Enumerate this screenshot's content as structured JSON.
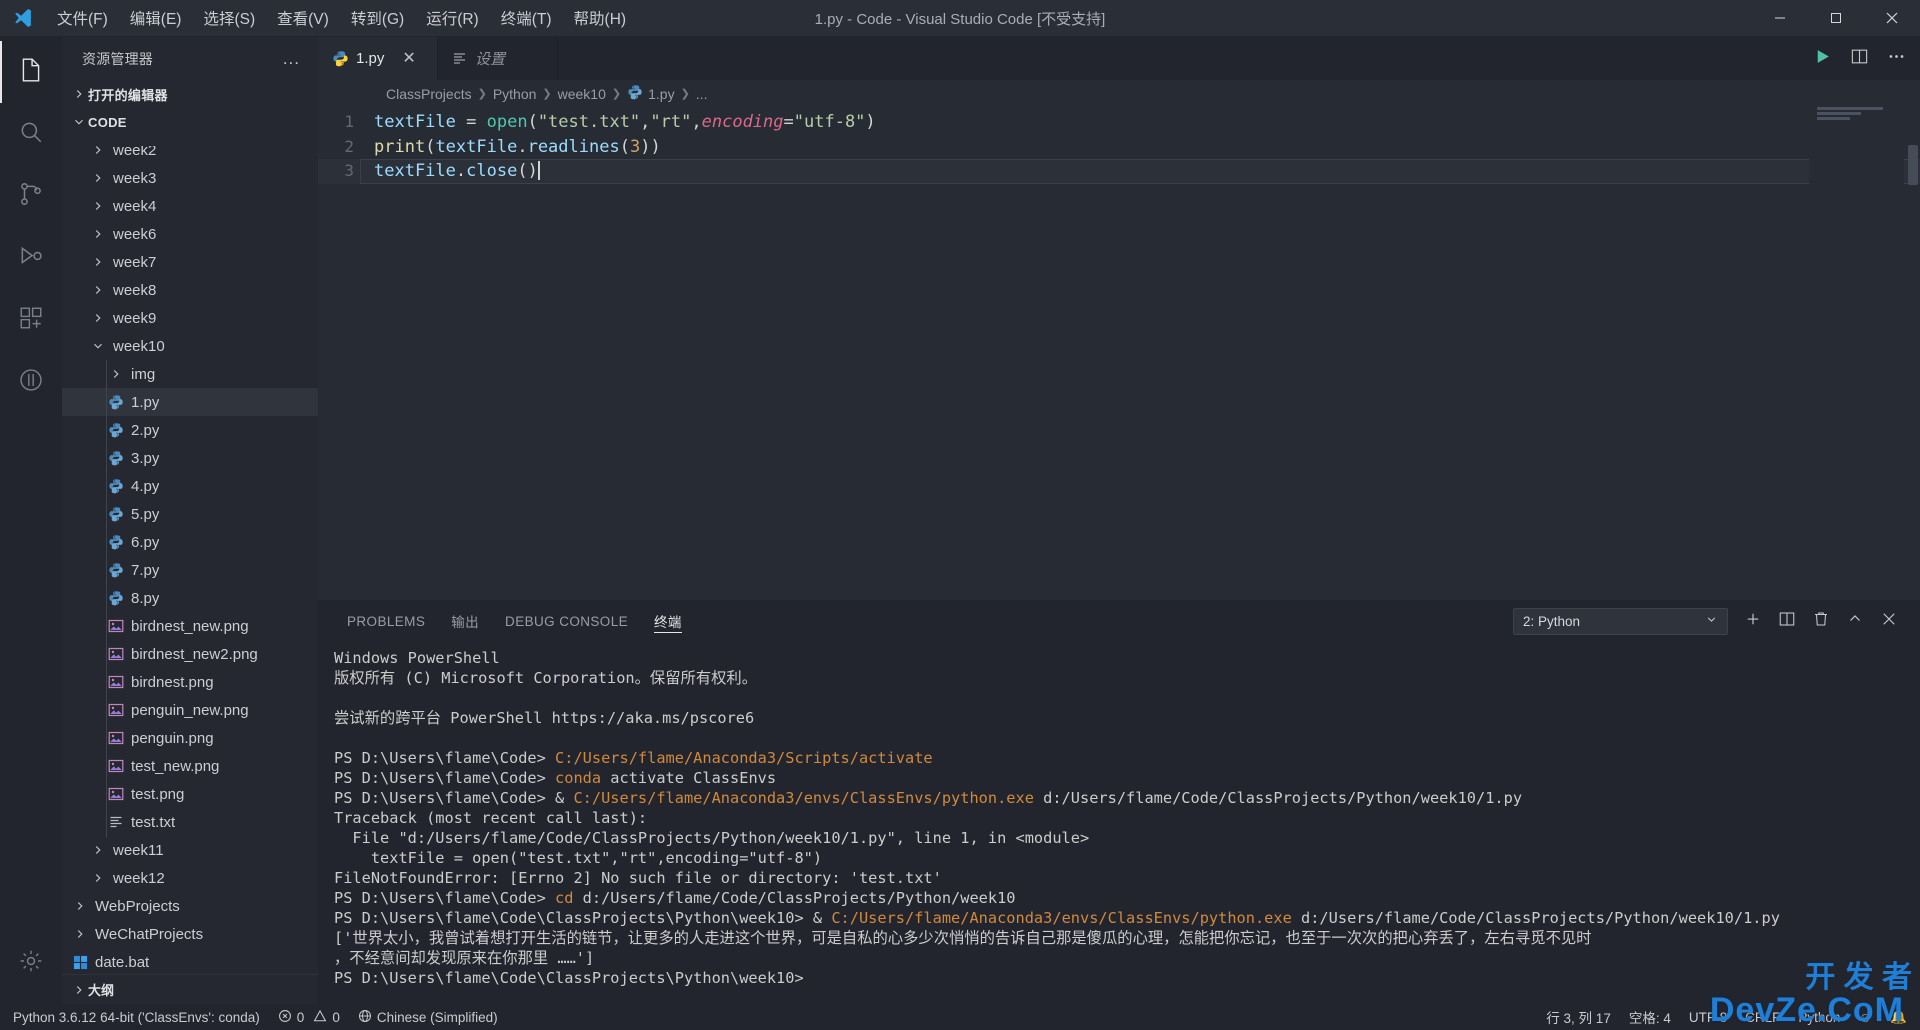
{
  "titlebar": {
    "title": "1.py - Code - Visual Studio Code [不受支持]",
    "menus": [
      "文件(F)",
      "编辑(E)",
      "选择(S)",
      "查看(V)",
      "转到(G)",
      "运行(R)",
      "终端(T)",
      "帮助(H)"
    ],
    "window_buttons": [
      "minimize",
      "maximize",
      "close"
    ]
  },
  "activitybar": {
    "items": [
      {
        "name": "explorer",
        "icon": "files-icon",
        "active": true
      },
      {
        "name": "search",
        "icon": "search-icon",
        "active": false
      },
      {
        "name": "source-control",
        "icon": "source-control-icon",
        "active": false
      },
      {
        "name": "run-and-debug",
        "icon": "run-debug-icon",
        "active": false
      },
      {
        "name": "extensions",
        "icon": "extensions-icon",
        "active": false
      },
      {
        "name": "testing",
        "icon": "beaker-icon",
        "active": false
      }
    ],
    "bottom": [
      {
        "name": "manage",
        "icon": "gear-icon"
      }
    ]
  },
  "sidebar": {
    "title": "资源管理器",
    "more_label": "...",
    "sections": [
      {
        "label": "打开的编辑器",
        "expanded": false
      },
      {
        "label": "CODE",
        "expanded": true
      }
    ],
    "outline_label": "大纲",
    "tree": [
      {
        "label": "week2",
        "icon": "folder",
        "depth": 2,
        "expanded": false,
        "clipped": true
      },
      {
        "label": "week3",
        "icon": "folder",
        "depth": 2,
        "expanded": false
      },
      {
        "label": "week4",
        "icon": "folder",
        "depth": 2,
        "expanded": false
      },
      {
        "label": "week6",
        "icon": "folder",
        "depth": 2,
        "expanded": false
      },
      {
        "label": "week7",
        "icon": "folder",
        "depth": 2,
        "expanded": false
      },
      {
        "label": "week8",
        "icon": "folder",
        "depth": 2,
        "expanded": false
      },
      {
        "label": "week9",
        "icon": "folder",
        "depth": 2,
        "expanded": false
      },
      {
        "label": "week10",
        "icon": "folder",
        "depth": 2,
        "expanded": true
      },
      {
        "label": "img",
        "icon": "folder",
        "depth": 3,
        "expanded": false
      },
      {
        "label": "1.py",
        "icon": "python",
        "depth": 3,
        "selected": true
      },
      {
        "label": "2.py",
        "icon": "python",
        "depth": 3
      },
      {
        "label": "3.py",
        "icon": "python",
        "depth": 3
      },
      {
        "label": "4.py",
        "icon": "python",
        "depth": 3
      },
      {
        "label": "5.py",
        "icon": "python",
        "depth": 3
      },
      {
        "label": "6.py",
        "icon": "python",
        "depth": 3
      },
      {
        "label": "7.py",
        "icon": "python",
        "depth": 3
      },
      {
        "label": "8.py",
        "icon": "python",
        "depth": 3
      },
      {
        "label": "birdnest_new.png",
        "icon": "image",
        "depth": 3
      },
      {
        "label": "birdnest_new2.png",
        "icon": "image",
        "depth": 3
      },
      {
        "label": "birdnest.png",
        "icon": "image",
        "depth": 3
      },
      {
        "label": "penguin_new.png",
        "icon": "image",
        "depth": 3
      },
      {
        "label": "penguin.png",
        "icon": "image",
        "depth": 3
      },
      {
        "label": "test_new.png",
        "icon": "image",
        "depth": 3
      },
      {
        "label": "test.png",
        "icon": "image",
        "depth": 3
      },
      {
        "label": "test.txt",
        "icon": "text",
        "depth": 3
      },
      {
        "label": "week11",
        "icon": "folder",
        "depth": 2,
        "expanded": false
      },
      {
        "label": "week12",
        "icon": "folder",
        "depth": 2,
        "expanded": false
      },
      {
        "label": "WebProjects",
        "icon": "folder",
        "depth": 1,
        "expanded": false
      },
      {
        "label": "WeChatProjects",
        "icon": "folder",
        "depth": 1,
        "expanded": false
      },
      {
        "label": "date.bat",
        "icon": "bat",
        "depth": 1
      }
    ]
  },
  "editor": {
    "tabs": [
      {
        "label": "1.py",
        "icon": "python-icon",
        "active": true,
        "closable": true,
        "italic": false
      },
      {
        "label": "设置",
        "icon": "settings-file-icon",
        "active": false,
        "closable": false,
        "italic": true
      }
    ],
    "actions": [
      "run-python-file-icon",
      "split-editor-icon",
      "more-actions-icon"
    ],
    "breadcrumb": [
      "ClassProjects",
      "Python",
      "week10",
      "1.py",
      "..."
    ],
    "lines": [
      {
        "num": "1",
        "tokens": [
          {
            "t": "textFile ",
            "c": "t-var"
          },
          {
            "t": "= ",
            "c": "t-plain"
          },
          {
            "t": "open",
            "c": "t-fn"
          },
          {
            "t": "(",
            "c": "t-punc"
          },
          {
            "t": "\"test.txt\"",
            "c": "t-str"
          },
          {
            "t": ",",
            "c": "t-punc"
          },
          {
            "t": "\"rt\"",
            "c": "t-str"
          },
          {
            "t": ",",
            "c": "t-punc"
          },
          {
            "t": "encoding",
            "c": "t-param"
          },
          {
            "t": "=",
            "c": "t-plain"
          },
          {
            "t": "\"utf-8\"",
            "c": "t-str"
          },
          {
            "t": ")",
            "c": "t-punc"
          }
        ]
      },
      {
        "num": "2",
        "tokens": [
          {
            "t": "print",
            "c": "t-fn2"
          },
          {
            "t": "(",
            "c": "t-punc"
          },
          {
            "t": "textFile",
            "c": "t-var"
          },
          {
            "t": ".",
            "c": "t-punc"
          },
          {
            "t": "readlines",
            "c": "t-var"
          },
          {
            "t": "(",
            "c": "t-punc"
          },
          {
            "t": "3",
            "c": "t-num"
          },
          {
            "t": "))",
            "c": "t-punc"
          }
        ]
      },
      {
        "num": "3",
        "current": true,
        "tokens": [
          {
            "t": "textFile",
            "c": "t-var"
          },
          {
            "t": ".",
            "c": "t-punc"
          },
          {
            "t": "close",
            "c": "t-var"
          },
          {
            "t": "()",
            "c": "t-punc"
          }
        ]
      }
    ]
  },
  "panel": {
    "tabs": [
      "PROBLEMS",
      "输出",
      "DEBUG CONSOLE",
      "终端"
    ],
    "active_tab": "终端",
    "terminal_selected": "2: Python",
    "actions": [
      "new-terminal-icon",
      "split-terminal-icon",
      "kill-terminal-icon",
      "maximize-panel-icon",
      "close-panel-icon"
    ],
    "terminal_lines": [
      [
        {
          "t": "Windows PowerShell",
          "c": "tm-dim"
        }
      ],
      [
        {
          "t": "版权所有 (C) Microsoft Corporation。保留所有权利。",
          "c": "tm-dim"
        }
      ],
      [
        {
          "t": "",
          "c": "tm-dim"
        }
      ],
      [
        {
          "t": "尝试新的跨平台 PowerShell https://aka.ms/pscore6",
          "c": "tm-dim"
        }
      ],
      [
        {
          "t": "",
          "c": "tm-dim"
        }
      ],
      [
        {
          "t": "PS D:\\Users\\flame\\Code> ",
          "c": "tm-dim"
        },
        {
          "t": "C:/Users/flame/Anaconda3/Scripts/activate",
          "c": "tm-orange"
        }
      ],
      [
        {
          "t": "PS D:\\Users\\flame\\Code> ",
          "c": "tm-dim"
        },
        {
          "t": "conda ",
          "c": "tm-orange"
        },
        {
          "t": "activate ClassEnvs",
          "c": "tm-dim"
        }
      ],
      [
        {
          "t": "PS D:\\Users\\flame\\Code> ",
          "c": "tm-dim"
        },
        {
          "t": "& ",
          "c": "tm-dim"
        },
        {
          "t": "C:/Users/flame/Anaconda3/envs/ClassEnvs/python.exe ",
          "c": "tm-orange"
        },
        {
          "t": "d:/Users/flame/Code/ClassProjects/Python/week10/1.py",
          "c": "tm-dim"
        }
      ],
      [
        {
          "t": "Traceback (most recent call last):",
          "c": "tm-dim"
        }
      ],
      [
        {
          "t": "  File \"d:/Users/flame/Code/ClassProjects/Python/week10/1.py\", line 1, in <module>",
          "c": "tm-dim"
        }
      ],
      [
        {
          "t": "    textFile = open(\"test.txt\",\"rt\",encoding=\"utf-8\")",
          "c": "tm-dim"
        }
      ],
      [
        {
          "t": "FileNotFoundError: [Errno 2] No such file or directory: 'test.txt'",
          "c": "tm-dim"
        }
      ],
      [
        {
          "t": "PS D:\\Users\\flame\\Code> ",
          "c": "tm-dim"
        },
        {
          "t": "cd ",
          "c": "tm-orange"
        },
        {
          "t": "d:/Users/flame/Code/ClassProjects/Python/week10",
          "c": "tm-dim"
        }
      ],
      [
        {
          "t": "PS D:\\Users\\flame\\Code\\ClassProjects\\Python\\week10> ",
          "c": "tm-dim"
        },
        {
          "t": "& ",
          "c": "tm-dim"
        },
        {
          "t": "C:/Users/flame/Anaconda3/envs/ClassEnvs/python.exe ",
          "c": "tm-orange"
        },
        {
          "t": "d:/Users/flame/Code/ClassProjects/Python/week10/1.py",
          "c": "tm-dim"
        }
      ],
      [
        {
          "t": "['世界太小，我曾试着想打开生活的链节，让更多的人走进这个世界，可是自私的心多少次悄悄的告诉自己那是傻瓜的心理，怎能把你忘记，也至于一次次的把心弃丢了，左右寻觅不见时",
          "c": "tm-dim"
        }
      ],
      [
        {
          "t": "，不经意间却发现原来在你那里 ……']",
          "c": "tm-dim"
        }
      ],
      [
        {
          "t": "PS D:\\Users\\flame\\Code\\ClassProjects\\Python\\week10>",
          "c": "tm-dim"
        }
      ]
    ]
  },
  "statusbar": {
    "left": [
      {
        "name": "python-interpreter",
        "label": "Python 3.6.12 64-bit ('ClassEnvs': conda)",
        "icon": null
      },
      {
        "name": "problems",
        "label": "0",
        "label2": "0",
        "icon": "error-warning-icon"
      },
      {
        "name": "language-pack",
        "label": "Chinese (Simplified)",
        "icon": "globe-icon"
      }
    ],
    "right": [
      {
        "name": "cursor-position",
        "label": "行 3, 列 17"
      },
      {
        "name": "indentation",
        "label": "空格: 4"
      },
      {
        "name": "encoding",
        "label": "UTF-8"
      },
      {
        "name": "eol",
        "label": "CRLF"
      },
      {
        "name": "language-mode",
        "label": "Python"
      },
      {
        "name": "feedback",
        "label": "☺"
      },
      {
        "name": "notifications",
        "label": "🔔"
      }
    ]
  },
  "watermark": {
    "text_cn": "开 发 者",
    "text_en": "DevZe.CoM"
  },
  "colors": {
    "titlebar_bg": "#2a2e37",
    "sidebar_bg": "#252830",
    "editor_bg": "#272b33",
    "panel_bg": "#22252d",
    "accent": "#1f7fd6",
    "terminal_orange": "#d1893c"
  }
}
